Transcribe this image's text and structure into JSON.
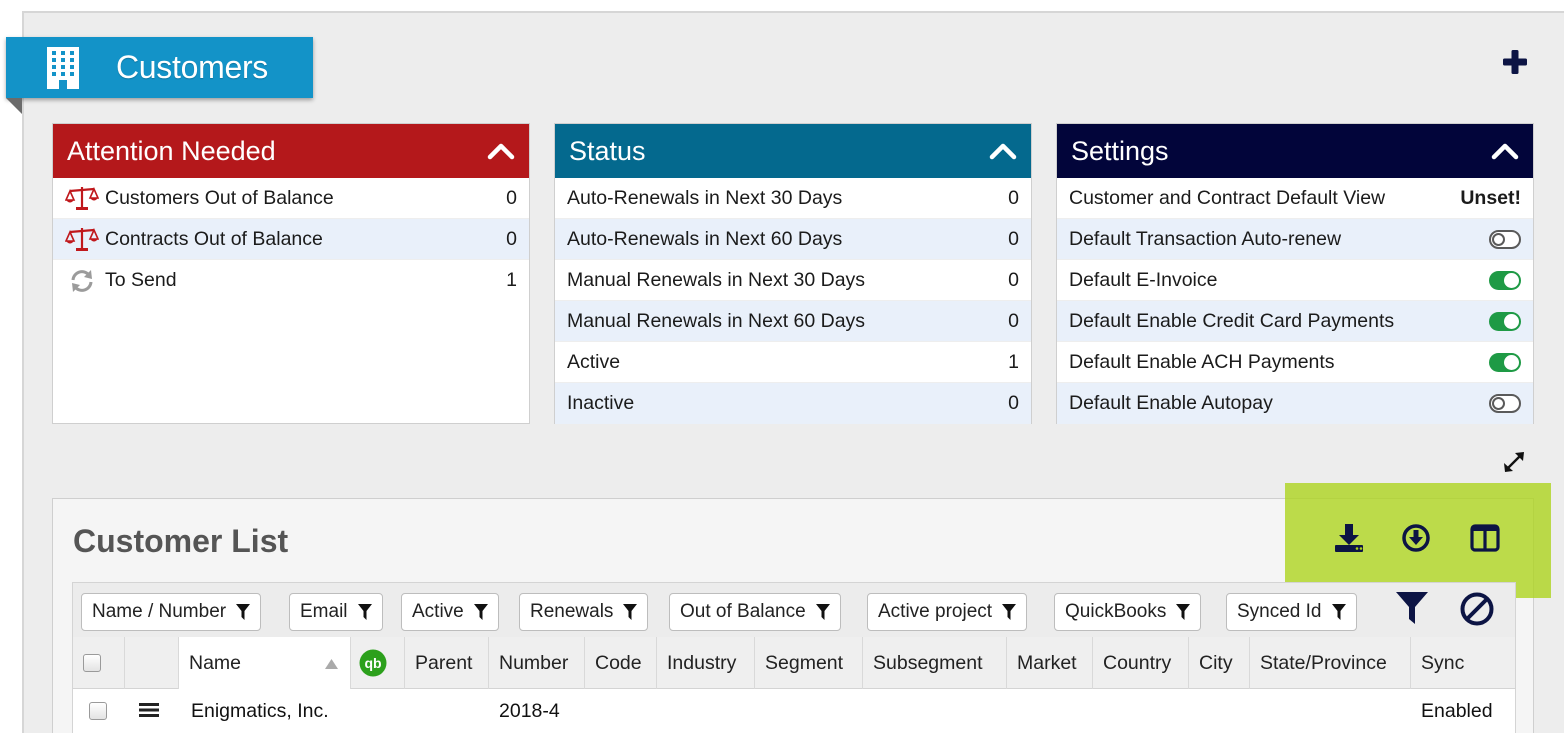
{
  "header": {
    "title": "Customers"
  },
  "panels": {
    "attention": {
      "title": "Attention Needed",
      "color": "#b4181b",
      "rows": [
        {
          "label": "Customers Out of Balance",
          "value": "0",
          "icon": "scales-icon"
        },
        {
          "label": "Contracts Out of Balance",
          "value": "0",
          "icon": "scales-icon"
        },
        {
          "label": "To Send",
          "value": "1",
          "icon": "refresh-icon"
        }
      ]
    },
    "status": {
      "title": "Status",
      "color": "#04698e",
      "rows": [
        {
          "label": "Auto-Renewals in Next 30 Days",
          "value": "0"
        },
        {
          "label": "Auto-Renewals in Next 60 Days",
          "value": "0"
        },
        {
          "label": "Manual Renewals in Next 30 Days",
          "value": "0"
        },
        {
          "label": "Manual Renewals in Next 60 Days",
          "value": "0"
        },
        {
          "label": "Active",
          "value": "1"
        },
        {
          "label": "Inactive",
          "value": "0"
        }
      ]
    },
    "settings": {
      "title": "Settings",
      "color": "#02053a",
      "rows": [
        {
          "label": "Customer and Contract Default View",
          "value": "Unset!"
        },
        {
          "label": "Default Transaction Auto-renew",
          "toggle": "off"
        },
        {
          "label": "Default E-Invoice",
          "toggle": "on"
        },
        {
          "label": "Default Enable Credit Card Payments",
          "toggle": "on"
        },
        {
          "label": "Default Enable ACH Payments",
          "toggle": "on"
        },
        {
          "label": "Default Enable Autopay",
          "toggle": "off"
        }
      ]
    }
  },
  "customer_list": {
    "title": "Customer List",
    "filters": [
      "Name / Number",
      "Email",
      "Active",
      "Renewals",
      "Out of Balance",
      "Active project",
      "QuickBooks",
      "Synced Id"
    ],
    "columns": [
      "Name",
      "Parent",
      "Number",
      "Code",
      "Industry",
      "Segment",
      "Subsegment",
      "Market",
      "Country",
      "City",
      "State/Province",
      "Sync"
    ],
    "quickbooks_badge": "qb",
    "rows": [
      {
        "name": "Enigmatics, Inc.",
        "number": "2018-4",
        "sync": "Enabled"
      }
    ]
  },
  "colors": {
    "ribbon": "#1393c8",
    "highlight": "#acd319",
    "toggle_on": "#1e9a45"
  }
}
